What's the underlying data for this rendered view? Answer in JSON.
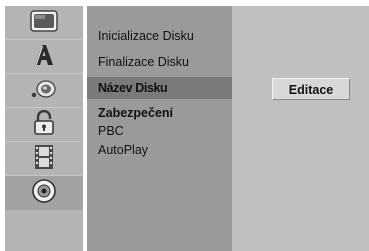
{
  "sidebar": {
    "items": [
      {
        "icon": "tv-screen-icon"
      },
      {
        "icon": "letter-a-icon"
      },
      {
        "icon": "speaker-icon"
      },
      {
        "icon": "padlock-icon"
      },
      {
        "icon": "film-strip-icon"
      },
      {
        "icon": "disc-icon",
        "selected": true
      }
    ]
  },
  "menu": {
    "items": [
      {
        "label": "Inicializace Disku"
      },
      {
        "label": "Finalizace Disku"
      },
      {
        "label": "Název Disku",
        "highlighted": true
      },
      {
        "label": "Zabezpečení",
        "bold": true
      },
      {
        "label": "PBC"
      },
      {
        "label": "AutoPlay"
      }
    ]
  },
  "action": {
    "label": "Editace"
  },
  "colors": {
    "sidebar_bg": "#b4b4b4",
    "menu_bg": "#9a9a9a",
    "highlight_bg": "#7a7a7a",
    "right_bg": "#c0c0c0",
    "button_bg": "#d8d8d8"
  }
}
